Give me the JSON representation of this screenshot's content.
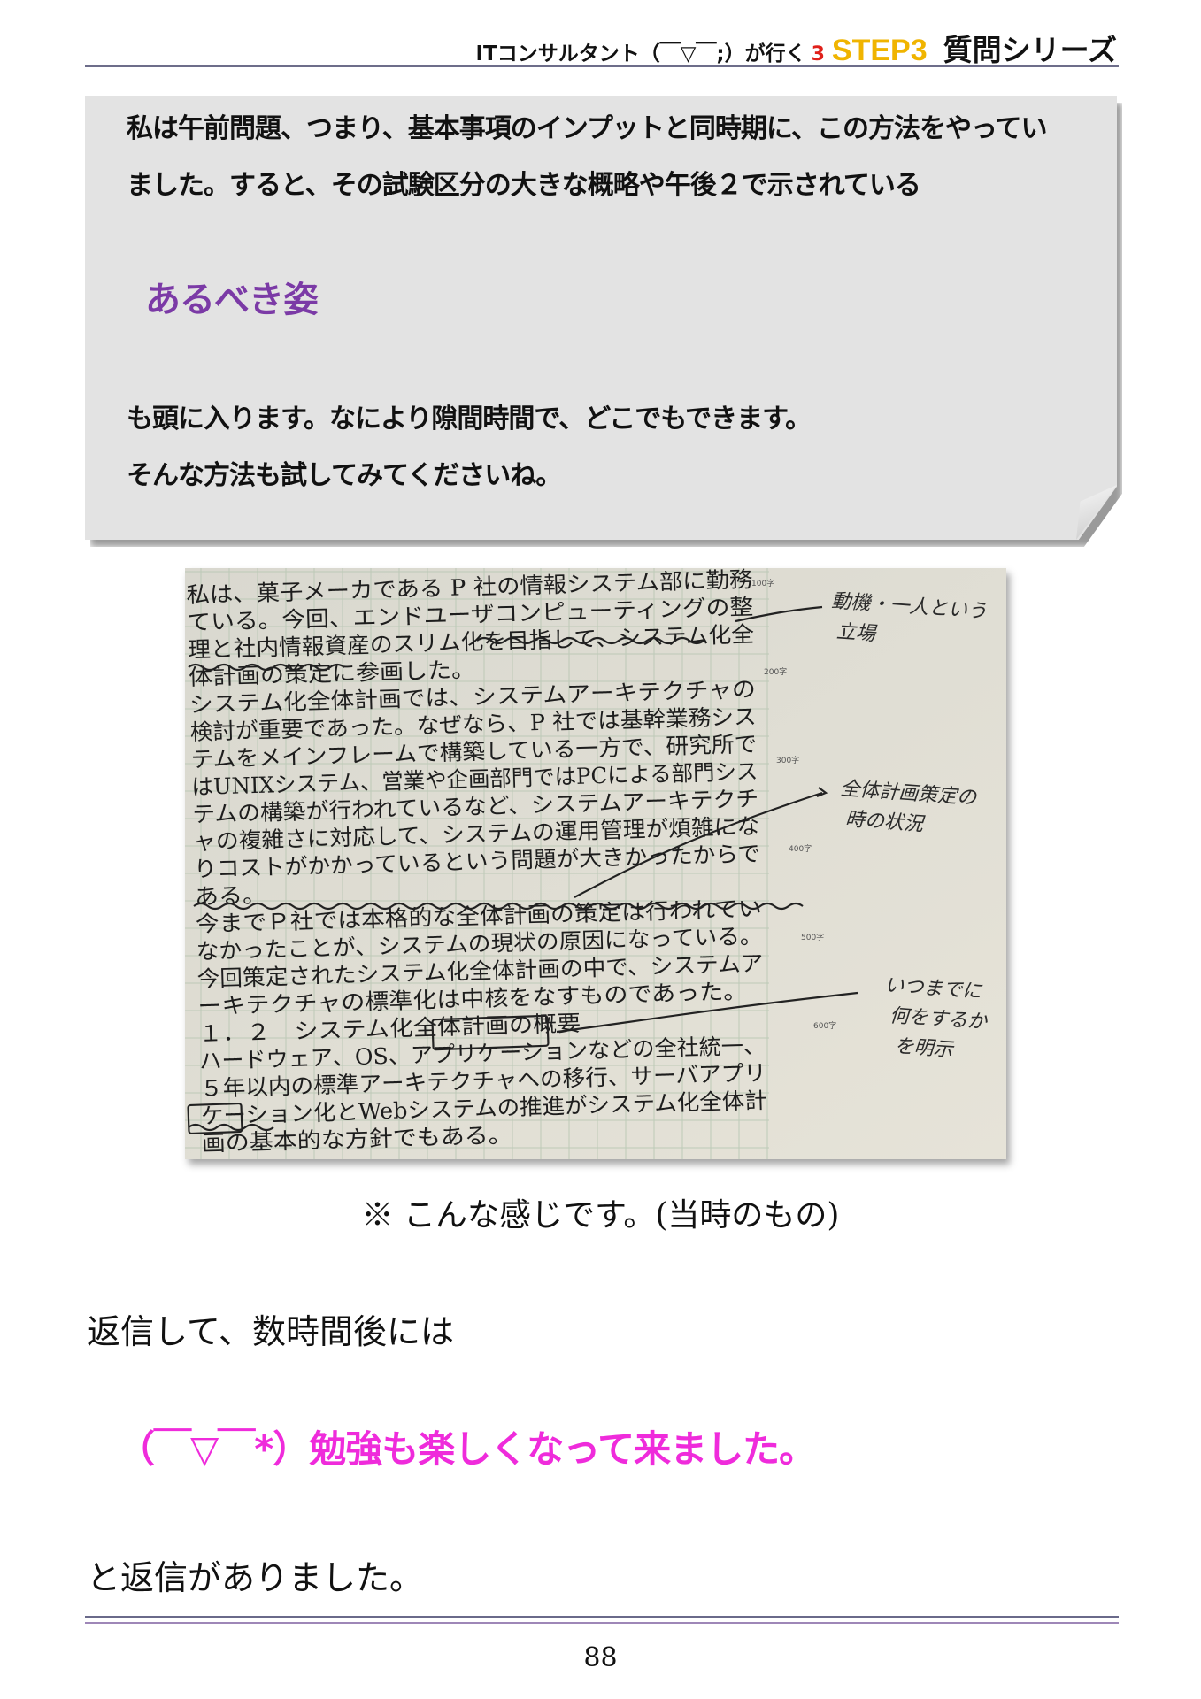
{
  "header": {
    "title": "ITコンサルタント（￣▽￣;）が行く",
    "number": "3",
    "step": "STEP3",
    "series": "質問シリーズ",
    "colors": {
      "number": "#e0201a",
      "step": "#f0b400"
    }
  },
  "callout": {
    "line1": "私は午前問題、つまり、基本事項のインプットと同時期に、この方法をやってい",
    "line2": "ました。すると、その試験区分の大きな概略や午後２で示されている",
    "highlight": "あるべき姿",
    "line3": "も頭に入ります。なにより隙間時間で、どこでもできます。",
    "line4": "そんな方法も試してみてくださいね。",
    "colors": {
      "background": "#e3e3e3",
      "highlight": "#7b3aa6"
    }
  },
  "photo": {
    "rows": [
      "私は、菓子メーカである P 社の情報システム部に勤務",
      "ている。今回、エンドユーザコンピューティングの整",
      "理と社内情報資産のスリム化を目指して、システム化全",
      "体計画の策定に参画した。",
      "システム化全体計画では、システムアーキテクチャの",
      "検討が重要であった。なぜなら、P 社では基幹業務シス",
      "テムをメインフレームで構築している一方で、研究所で",
      "はUNIXシステム、営業や企画部門ではPCによる部門シス",
      "テムの構築が行われているなど、システムアーキテクチ",
      "ャの複雑さに対応して、システムの運用管理が煩雑にな",
      "りコストがかかっているという問題が大きかったからで",
      "ある。",
      "今までＰ社では本格的な全体計画の策定は行われてい",
      "なかったことが、システムの現状の原因になっている。",
      "今回策定されたシステム化全体計画の中で、システムア",
      "ーキテクチャの標準化は中核をなすものであった。",
      "１．２　システム化全体計画の概要",
      "ハードウェア、OS、アプリケーションなどの全社統一、",
      "５年以内の標準アーキテクチャへの移行、サーバアプリ",
      "ケーション化とWebシステムの推進がシステム化全体計",
      "画の基本的な方針でもある。"
    ],
    "margin_marks": [
      "100字",
      "200字",
      "300字",
      "400字",
      "500字",
      "600字"
    ],
    "notes": [
      [
        "動機・一人という",
        "立場"
      ],
      [
        "全体計画策定の",
        "時の状況"
      ],
      [
        "いつまでに",
        "何をするか",
        "を明示"
      ]
    ]
  },
  "caption": "※ こんな感じです。(当時のもの)",
  "reply_intro": "返信して、数時間後には",
  "reply_quote": "（￣▽￣*）勉強も楽しくなって来ました。",
  "reply_outro": "と返信がありました。",
  "page_number": "88",
  "colors": {
    "quote": "#ef2bdb"
  }
}
